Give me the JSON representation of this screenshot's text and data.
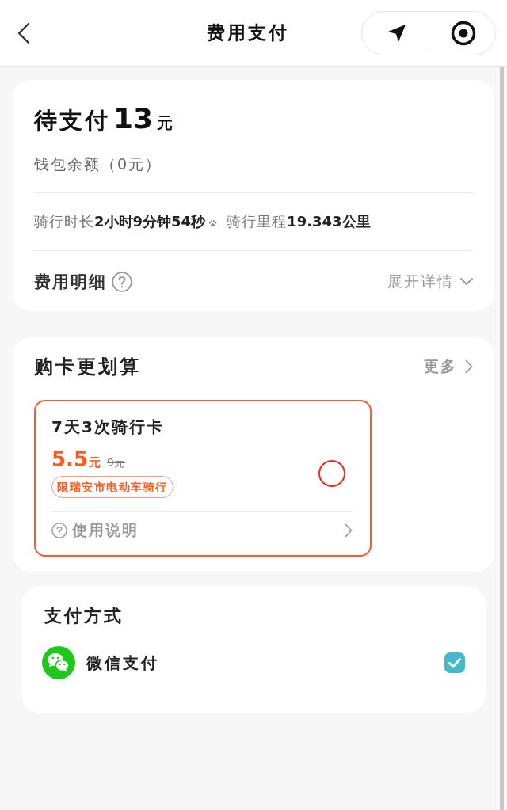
{
  "header": {
    "title": "费用支付"
  },
  "fee_card": {
    "pending_label": "待支付",
    "pending_amount": "13",
    "pending_unit": "元",
    "wallet_balance": "钱包余额（0元）",
    "ride_duration": "骑行时长**2小时9分钟54秒**",
    "ride_distance": "骑行里程**19.343公里**",
    "details_label": "费用明细",
    "expand_label": "展开详情",
    "expanded": false
  },
  "card_offer": {
    "title": "购卡更划算",
    "more": "更多",
    "cards": [
      {
        "name": "7天3次骑行卡",
        "price": "5.5",
        "price_unit": "元",
        "original_price": "9元",
        "tag": "限瑞安市电动车骑行",
        "selected": false,
        "instructions": "使用说明"
      }
    ]
  },
  "payment": {
    "title": "支付方式",
    "methods": [
      {
        "name": "微信支付",
        "selected": true
      }
    ]
  }
}
